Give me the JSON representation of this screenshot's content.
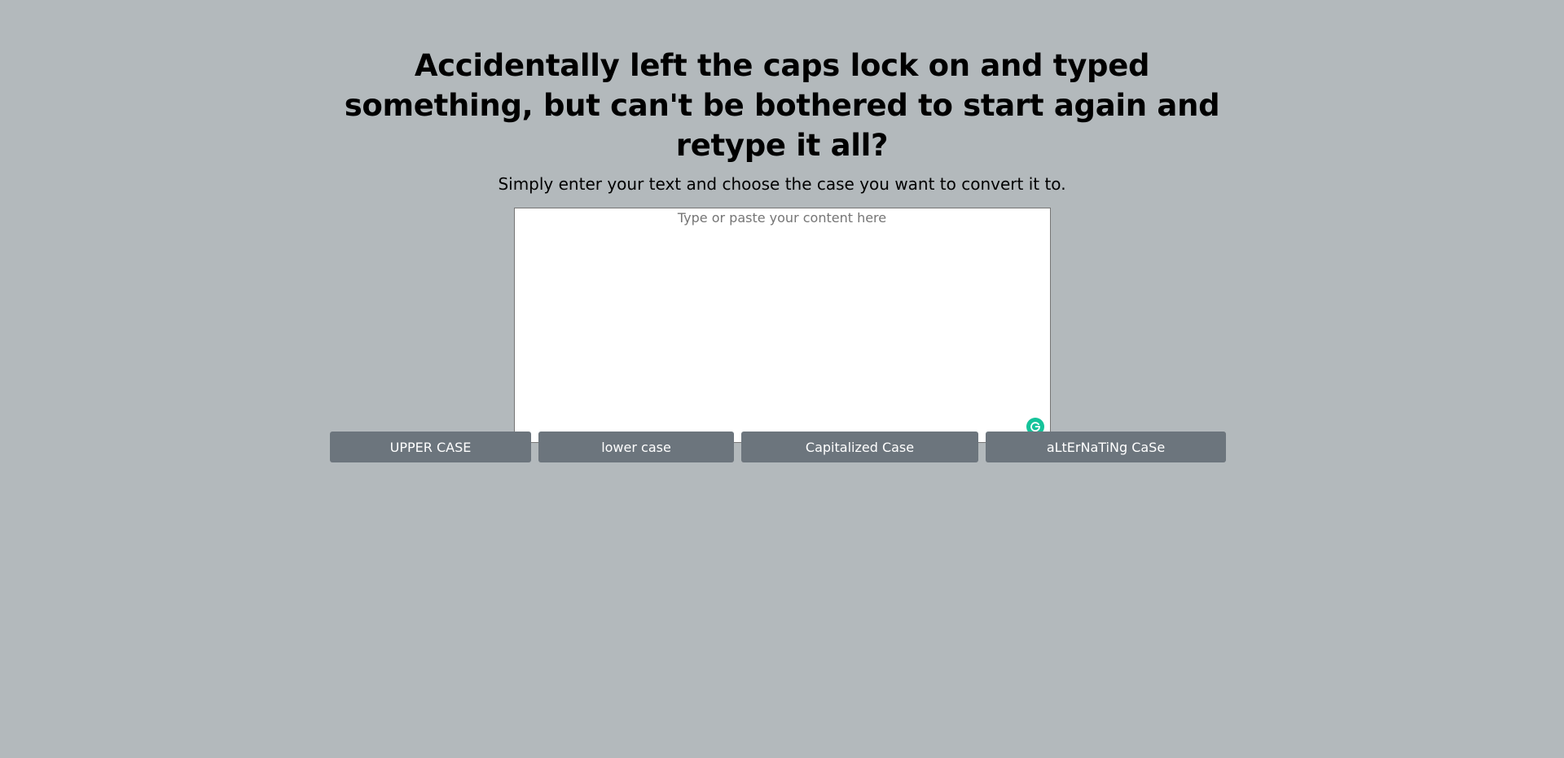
{
  "header": {
    "title": "Accidentally left the caps lock on and typed something, but can't be bothered to start again and retype it all?",
    "subtitle": "Simply enter your text and choose the case you want to convert it to."
  },
  "editor": {
    "value": "",
    "placeholder": "Type or paste your content here",
    "assistant_icon": "grammarly-icon",
    "assistant_color": "#15c39a"
  },
  "buttons": {
    "upper": "UPPER CASE",
    "lower": "lower case",
    "capitalized": "Capitalized Case",
    "alternating": "aLtErNaTiNg CaSe"
  },
  "colors": {
    "background": "#b3b9bc",
    "button": "#6c757d",
    "button_text": "#ffffff"
  }
}
